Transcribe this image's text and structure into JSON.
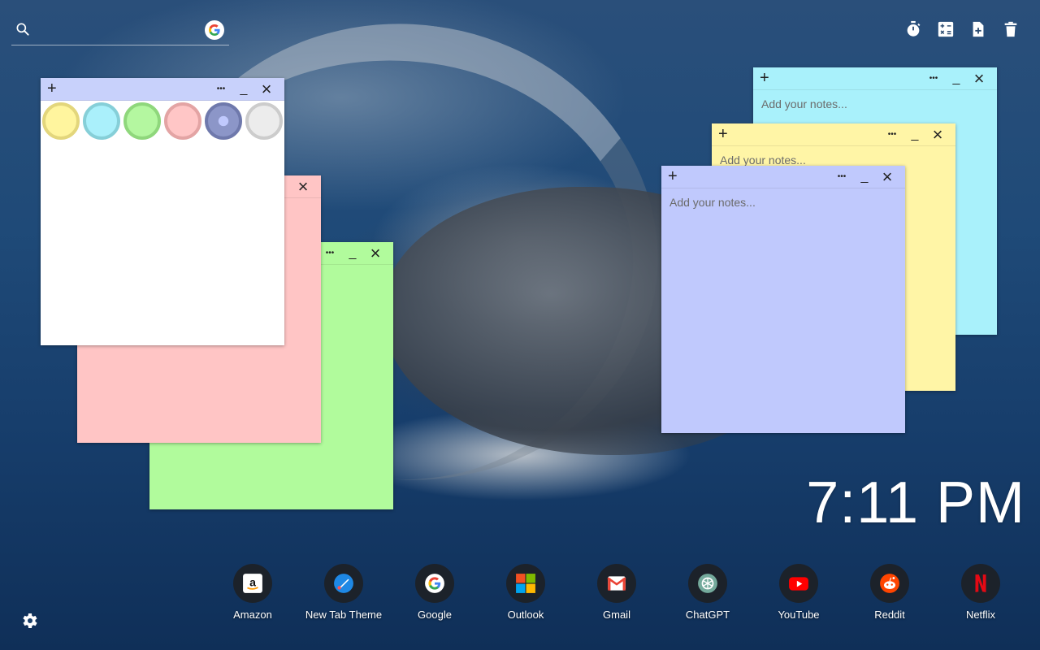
{
  "search": {
    "placeholder": "",
    "value": ""
  },
  "toolbar": {
    "icons": [
      "timer-icon",
      "calculator-icon",
      "add-note-icon",
      "trash-icon"
    ]
  },
  "notes": {
    "white": {
      "color": "#ffffff",
      "header_color": "#c8d1fb"
    },
    "pink": {
      "color": "#ffc5c5",
      "header_color": "#ffc5c5"
    },
    "green": {
      "color": "#b1fb9c",
      "header_color": "#b1fb9c"
    },
    "cyan": {
      "placeholder": "Add your notes...",
      "color": "#a9f1fb"
    },
    "yellow": {
      "placeholder": "Add your notes...",
      "color": "#fff5a6"
    },
    "blue": {
      "placeholder": "Add your notes...",
      "color": "#c0c9fd"
    },
    "palette": [
      {
        "name": "yellow",
        "fill": "#fff59e",
        "ring": "#e3d67c"
      },
      {
        "name": "cyan",
        "fill": "#aaf0fb",
        "ring": "#86cfd8"
      },
      {
        "name": "green",
        "fill": "#b4f7a0",
        "ring": "#8fd77c"
      },
      {
        "name": "pink",
        "fill": "#ffc6c6",
        "ring": "#e3a4a4"
      },
      {
        "name": "periwinkle",
        "fill": "#8c96c8",
        "ring": "#6f79ac"
      },
      {
        "name": "gray",
        "fill": "#ececec",
        "ring": "#cccccc"
      }
    ],
    "header_buttons": {
      "add": "+",
      "more": "•••",
      "minimize": "_",
      "close": "×"
    }
  },
  "clock": {
    "time": "7:11 PM"
  },
  "shortcuts": [
    {
      "label": "Amazon",
      "icon": "amazon-icon"
    },
    {
      "label": "New Tab Theme",
      "icon": "new-tab-theme-icon"
    },
    {
      "label": "Google",
      "icon": "google-icon"
    },
    {
      "label": "Outlook",
      "icon": "outlook-icon"
    },
    {
      "label": "Gmail",
      "icon": "gmail-icon"
    },
    {
      "label": "ChatGPT",
      "icon": "chatgpt-icon"
    },
    {
      "label": "YouTube",
      "icon": "youtube-icon"
    },
    {
      "label": "Reddit",
      "icon": "reddit-icon"
    },
    {
      "label": "Netflix",
      "icon": "netflix-icon"
    }
  ],
  "settings": {
    "icon": "gear-icon"
  }
}
